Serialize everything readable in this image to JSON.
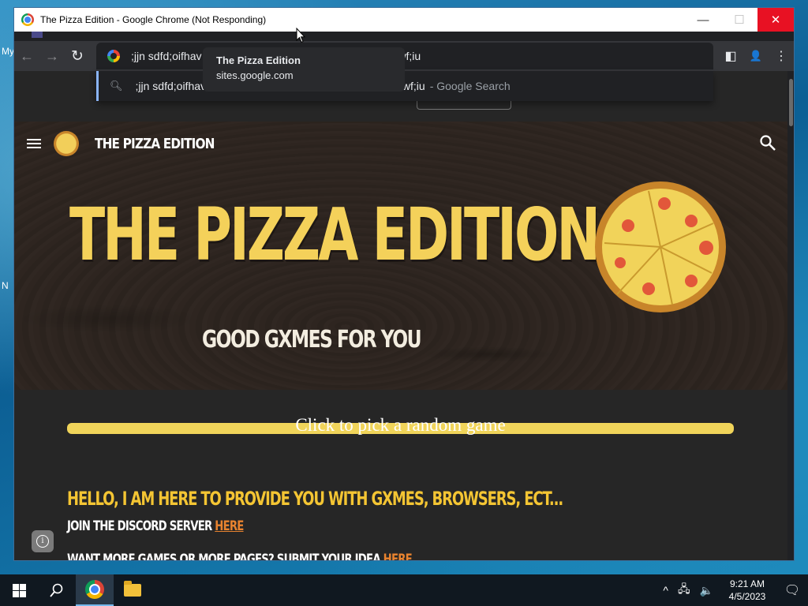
{
  "desktop": {
    "label_my": "My",
    "label_n": "N"
  },
  "window": {
    "title": "The Pizza Edition - Google Chrome (Not Responding)",
    "minimize_glyph": "—",
    "maximize_glyph": "☐",
    "close_glyph": "✕"
  },
  "toolbar": {
    "back_glyph": "←",
    "forward_glyph": "→",
    "reload_glyph": "↻",
    "omnibox_value": ";jjn sdfd;oifhav",
    "omnibox_tail": "iuwf;iu",
    "side_panel_glyph": "◧",
    "profile_glyph": "👤",
    "menu_glyph": "⋮"
  },
  "suggestion": {
    "query": ";jjn sdfd;oifhav",
    "query_tail": "iuwf;iu",
    "source": "- Google Search"
  },
  "tooltip": {
    "title": "The Pizza Edition",
    "url": "sites.google.com"
  },
  "site": {
    "name": "THE PIZZA EDITION",
    "hero_title": "THE PIZZA EDITION",
    "tagline": "GOOD GXMES FOR YOU",
    "random_button": "Click to pick a random game",
    "hello_heading": "HELLO, I AM HERE TO PROVIDE YOU WITH GXMES, BROWSERS, ECT...",
    "discord_text": "JOIN THE DISCORD SERVER ",
    "discord_link": "HERE",
    "submit_text": "WANT MORE GAMES OR MORE PAGES? SUBMIT YOUR IDEA ",
    "submit_link": "HERE",
    "info_glyph": "i"
  },
  "taskbar": {
    "time": "9:21 AM",
    "date": "4/5/2023",
    "tray_chevron": "^",
    "tray_network": "🖧",
    "tray_volume": "🔈",
    "notification_glyph": "🗨"
  },
  "colors": {
    "accent_yellow": "#f4d15a",
    "link_orange": "#e8832f",
    "close_red": "#e81123"
  }
}
